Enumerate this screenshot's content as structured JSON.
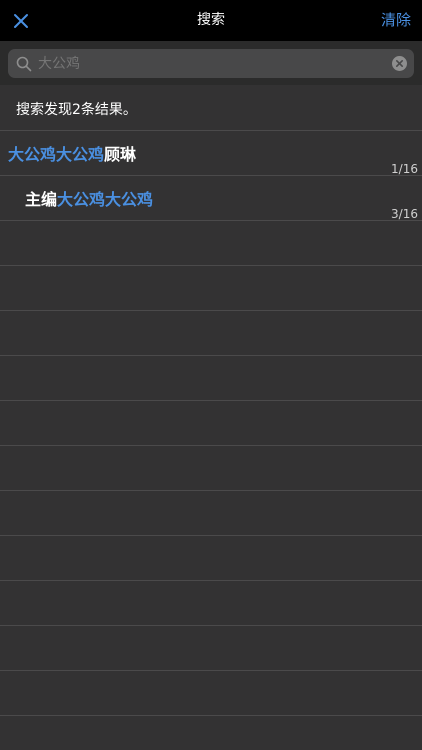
{
  "navbar": {
    "title": "搜索",
    "clear_label": "清除",
    "close_icon": "close-icon"
  },
  "search": {
    "value": "",
    "placeholder": "大公鸡",
    "search_icon": "search-icon",
    "clear_icon": "clear-input-icon"
  },
  "summary": "搜索发现2条结果。",
  "results": [
    {
      "pre": "",
      "hl": "大公鸡大公鸡",
      "post": "顾琳",
      "page": "1/16",
      "indent": false
    },
    {
      "pre": "主编",
      "hl": "大公鸡大公鸡",
      "post": "",
      "page": "3/16",
      "indent": true
    }
  ],
  "colors": {
    "accent": "#4a90e2",
    "background": "#333233",
    "navbar": "#000000",
    "separator": "#4b4a4b"
  }
}
